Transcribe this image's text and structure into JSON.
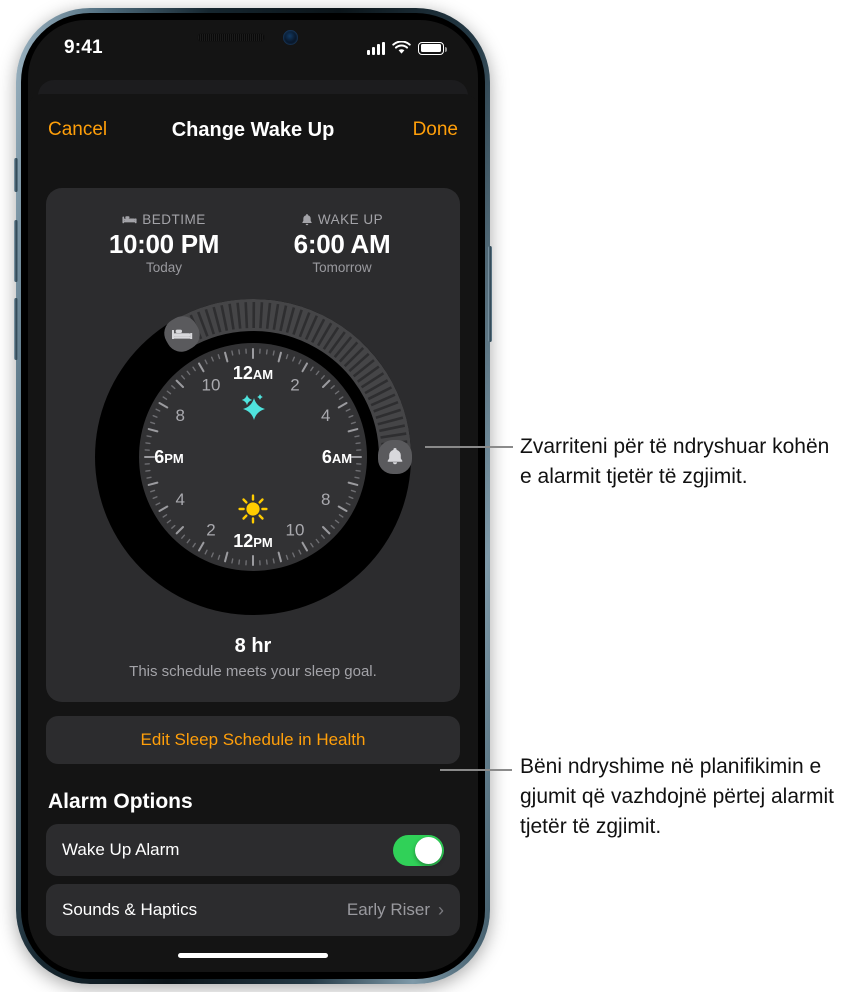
{
  "status_bar": {
    "time": "9:41",
    "cellular_icon": "signal-bars-icon",
    "wifi_icon": "wifi-icon",
    "battery_icon": "battery-icon"
  },
  "navbar": {
    "cancel_label": "Cancel",
    "title": "Change Wake Up",
    "done_label": "Done"
  },
  "schedule_card": {
    "bedtime": {
      "icon": "bed-icon",
      "label": "BEDTIME",
      "time": "10:00 PM",
      "day": "Today"
    },
    "wakeup": {
      "icon": "bell-icon",
      "label": "WAKE UP",
      "time": "6:00 AM",
      "day": "Tomorrow"
    },
    "dial": {
      "labels": [
        "12AM",
        "2",
        "4",
        "6AM",
        "8",
        "10",
        "12PM",
        "2",
        "4",
        "6PM",
        "8",
        "10"
      ],
      "moon_icon": "sparkle-stars-icon",
      "sun_icon": "sun-icon",
      "bed_handle_icon": "bed-icon",
      "bell_handle_icon": "bell-icon",
      "sleep_start_hour": 22,
      "sleep_end_hour": 6
    },
    "duration": "8 hr",
    "goal_message": "This schedule meets your sleep goal."
  },
  "edit_schedule": {
    "label": "Edit Sleep Schedule in Health"
  },
  "alarm_options": {
    "section_title": "Alarm Options",
    "rows": [
      {
        "label": "Wake Up Alarm",
        "type": "toggle",
        "value": "on"
      },
      {
        "label": "Sounds & Haptics",
        "type": "disclosure",
        "value": "Early Riser",
        "chevron": "chevron-right-icon"
      }
    ]
  },
  "annotations": [
    {
      "text": "Zvarriteni për të ndryshuar kohën e alarmit tjetër të zgjimit."
    },
    {
      "text": "Bëni ndryshime në planifikimin e gjumit që vazhdojnë përtej alarmit tjetër të zgjimit."
    }
  ],
  "colors": {
    "accent_orange": "#ff9f0a",
    "toggle_green": "#30d158",
    "card_bg": "#2c2c2e",
    "screen_bg": "#141414",
    "sun_yellow": "#ffcc00",
    "moon_cyan": "#4fe3dd"
  }
}
